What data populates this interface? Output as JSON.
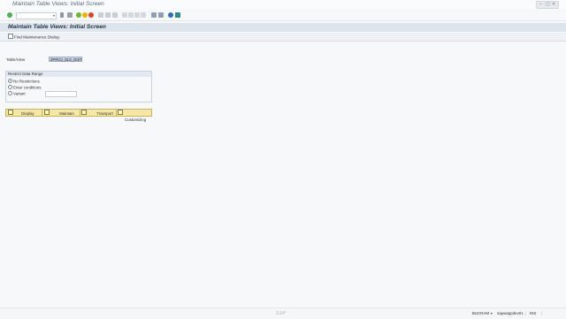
{
  "window": {
    "title": "Maintain Table Views: Initial Screen"
  },
  "toolbar": {
    "command_field_value": "",
    "command_dropdown": "▾",
    "buttons": [
      {
        "name": "enter-icon",
        "color": "#4caf50"
      },
      {
        "name": "save-icon",
        "color": "#9aa3ad"
      },
      {
        "name": "back-icon",
        "color": "#6db33f"
      },
      {
        "name": "exit-icon",
        "color": "#f0b400"
      },
      {
        "name": "cancel-icon",
        "color": "#d9452f"
      },
      {
        "name": "print-icon",
        "color": "#b7bec6"
      },
      {
        "name": "find-icon",
        "color": "#b7bec6"
      },
      {
        "name": "find-next-icon",
        "color": "#b7bec6"
      },
      {
        "name": "first-page-icon",
        "color": "#c5ccd4"
      },
      {
        "name": "prev-page-icon",
        "color": "#c5ccd4"
      },
      {
        "name": "next-page-icon",
        "color": "#c5ccd4"
      },
      {
        "name": "last-page-icon",
        "color": "#c5ccd4"
      },
      {
        "name": "new-session-icon",
        "color": "#7d8fa6"
      },
      {
        "name": "shortcut-icon",
        "color": "#7d8fa6"
      },
      {
        "name": "help-icon",
        "color": "#2f6fb5"
      },
      {
        "name": "layout-icon",
        "color": "#2f8a86"
      }
    ]
  },
  "screen": {
    "title": "Maintain Table Views: Initial Screen"
  },
  "app_toolbar": {
    "find_button_label": "Find Maintenance Dialog"
  },
  "form": {
    "table_view_label": "Table/View",
    "table_view_value": "ZPROJ_SLS_DIST",
    "restrict_group_title": "Restrict Data Range",
    "options": [
      {
        "label": "No Restrictions",
        "selected": true
      },
      {
        "label": "Enter conditions",
        "selected": false
      },
      {
        "label": "Variant",
        "selected": false
      }
    ],
    "variant_value": ""
  },
  "actions": {
    "display": "Display",
    "maintain": "Maintain",
    "transport": "Transport",
    "customizing": "Customizing"
  },
  "status_bar": {
    "brand": "SAP",
    "transaction": "BUCRAM",
    "server": "sapwappdev01",
    "mode": "INS"
  }
}
